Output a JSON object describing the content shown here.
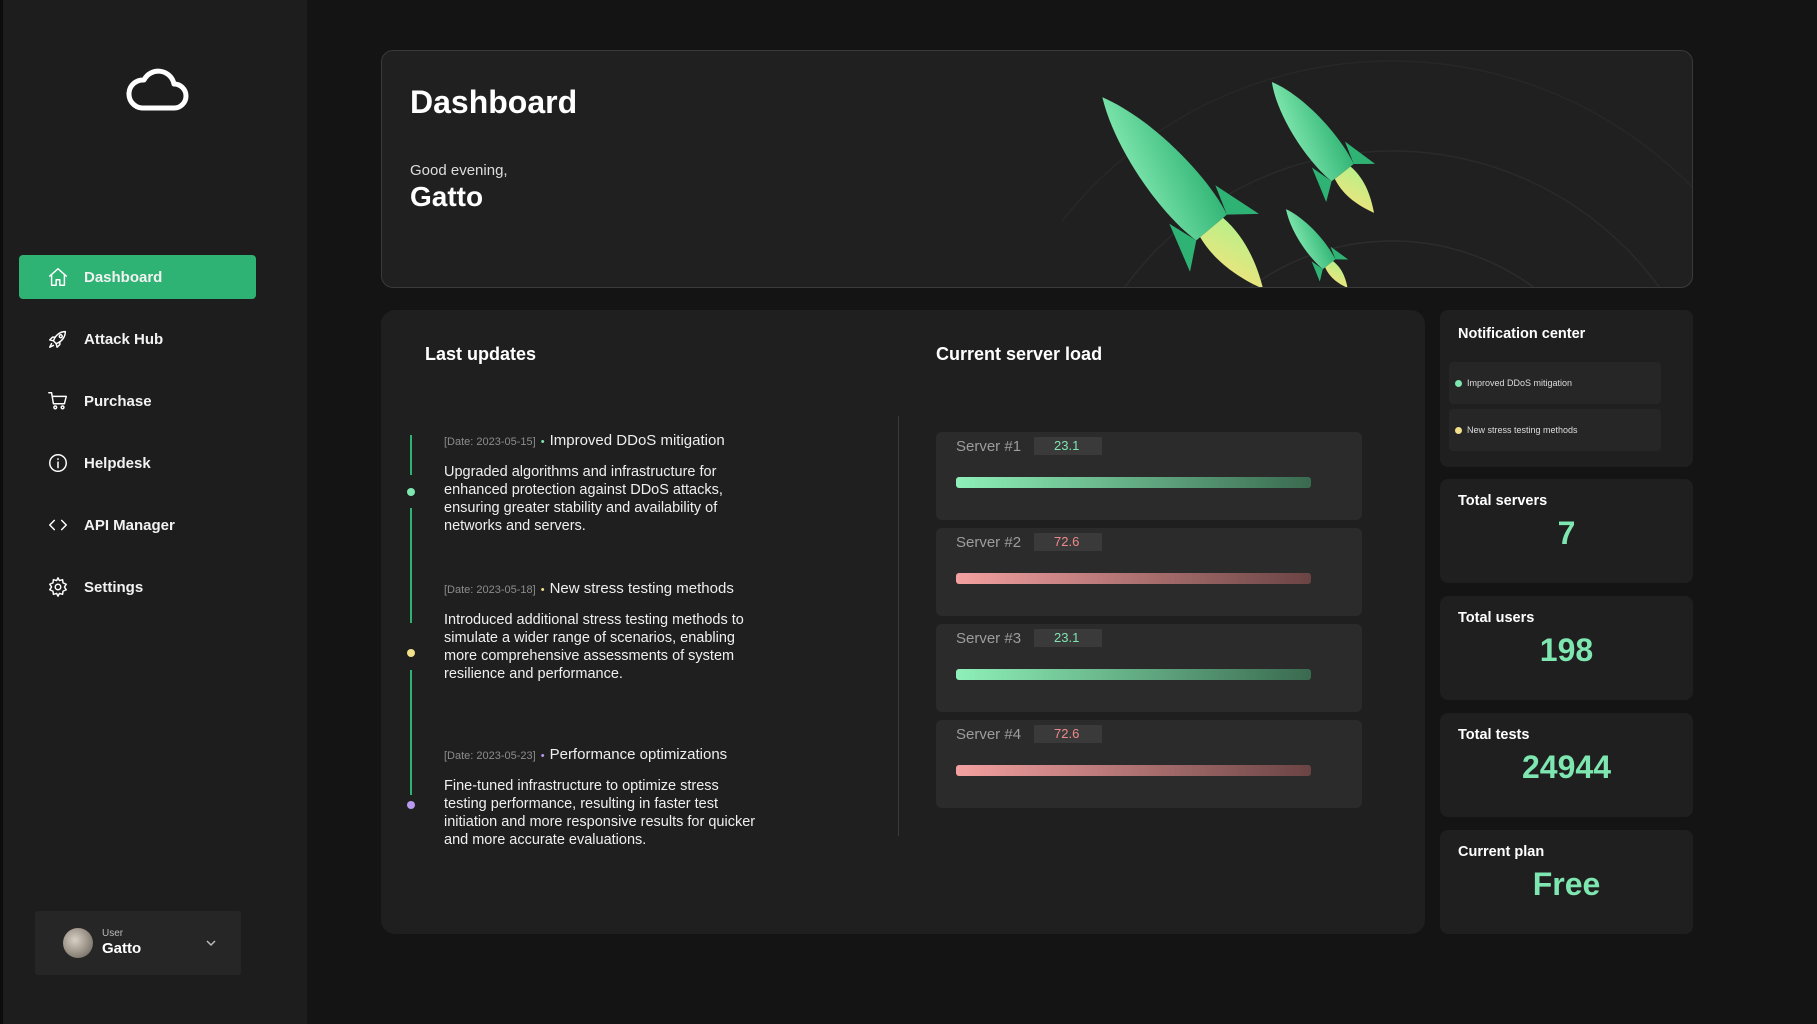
{
  "sidebar": {
    "logo": "cloud-icon",
    "items": [
      {
        "label": "Dashboard",
        "icon": "home-icon",
        "active": true
      },
      {
        "label": "Attack Hub",
        "icon": "rocket-icon",
        "active": false
      },
      {
        "label": "Purchase",
        "icon": "cart-icon",
        "active": false
      },
      {
        "label": "Helpdesk",
        "icon": "info-icon",
        "active": false
      },
      {
        "label": "API Manager",
        "icon": "code-icon",
        "active": false
      },
      {
        "label": "Settings",
        "icon": "gear-icon",
        "active": false
      }
    ],
    "user": {
      "role": "User",
      "name": "Gatto"
    }
  },
  "hero": {
    "title": "Dashboard",
    "greeting": "Good evening,",
    "name": "Gatto"
  },
  "updates": {
    "title": "Last updates",
    "items": [
      {
        "date": "[Date: 2023-05-15]",
        "title": "Improved DDoS mitigation",
        "body": "Upgraded algorithms and infrastructure for enhanced protection against DDoS attacks, ensuring greater stability and availability of networks and servers.",
        "color": "#7ee6b0"
      },
      {
        "date": "[Date: 2023-05-18]",
        "title": "New stress testing methods",
        "body": "Introduced additional stress testing methods to simulate a wider range of scenarios, enabling more comprehensive assessments of system resilience and performance.",
        "color": "#f2e08a"
      },
      {
        "date": "[Date: 2023-05-23]",
        "title": "Performance optimizations",
        "body": "Fine-tuned infrastructure to optimize stress testing performance, resulting in faster test initiation and more responsive results for quicker and more accurate evaluations.",
        "color": "#b79af0"
      }
    ]
  },
  "servers": {
    "title": "Current server load",
    "items": [
      {
        "name": "Server #1",
        "value": "23.1",
        "status": "good",
        "color": "#7ee6b0"
      },
      {
        "name": "Server #2",
        "value": "72.6",
        "status": "high",
        "color": "#f08a8a"
      },
      {
        "name": "Server #3",
        "value": "23.1",
        "status": "good",
        "color": "#7ee6b0"
      },
      {
        "name": "Server #4",
        "value": "72.6",
        "status": "high",
        "color": "#f08a8a"
      }
    ]
  },
  "notifications": {
    "title": "Notification center",
    "items": [
      {
        "text": "Improved DDoS mitigation",
        "color": "#7ee6b0"
      },
      {
        "text": "New stress testing methods",
        "color": "#f2e08a"
      }
    ]
  },
  "stats": {
    "total_servers": {
      "label": "Total servers",
      "value": "7"
    },
    "total_users": {
      "label": "Total users",
      "value": "198"
    },
    "total_tests": {
      "label": "Total tests",
      "value": "24944"
    },
    "current_plan": {
      "label": "Current plan",
      "value": "Free"
    }
  },
  "colors": {
    "accent": "#2fb374",
    "value_green": "#7ee6b0",
    "load_high": "#f08a8a"
  }
}
